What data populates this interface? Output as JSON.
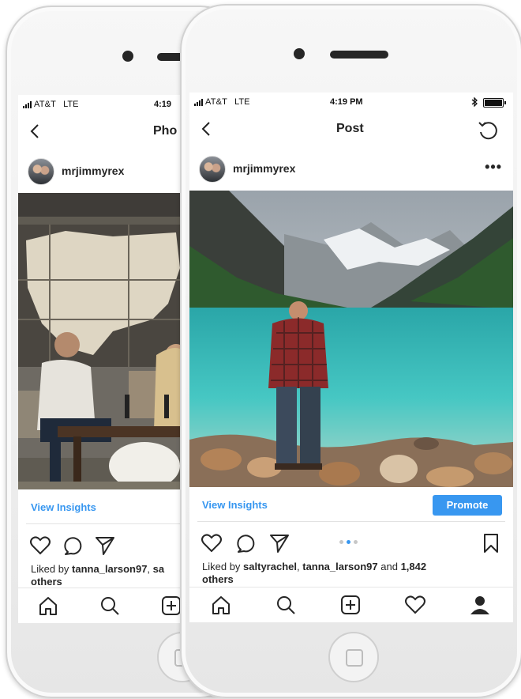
{
  "colors": {
    "accent": "#3897f0",
    "text": "#262626",
    "divider": "#e2e2e2"
  },
  "back_phone": {
    "status": {
      "carrier": "AT&T",
      "network": "LTE",
      "time": "4:19"
    },
    "nav": {
      "title": "Pho"
    },
    "post": {
      "username": "mrjimmyrex"
    },
    "insights_label": "View Insights",
    "likes": {
      "prefix": "Liked by",
      "user1": "tanna_larson97",
      "user2_partial": "sa",
      "suffix": "others"
    },
    "icons": {
      "back": "chevron-left-icon",
      "heart": "heart-icon",
      "comment": "comment-icon",
      "share": "paper-plane-icon",
      "home": "home-icon",
      "search": "search-icon",
      "add": "add-post-icon"
    }
  },
  "front_phone": {
    "status": {
      "carrier": "AT&T",
      "network": "LTE",
      "time": "4:19 PM"
    },
    "nav": {
      "title": "Post"
    },
    "post": {
      "username": "mrjimmyrex",
      "more_label": "•••"
    },
    "insights_label": "View Insights",
    "promote_label": "Promote",
    "carousel": {
      "count": 3,
      "active_index": 1
    },
    "likes": {
      "prefix": "Liked by",
      "user1": "saltyrachel",
      "separator": ",",
      "user2": "tanna_larson97",
      "conjunction": "and",
      "count": "1,842",
      "suffix": "others"
    },
    "icons": {
      "back": "chevron-left-icon",
      "refresh": "refresh-icon",
      "heart": "heart-icon",
      "comment": "comment-icon",
      "share": "paper-plane-icon",
      "bookmark": "bookmark-icon",
      "home": "home-icon",
      "search": "search-icon",
      "add": "add-post-icon",
      "activity": "heart-icon",
      "profile": "profile-icon"
    }
  }
}
